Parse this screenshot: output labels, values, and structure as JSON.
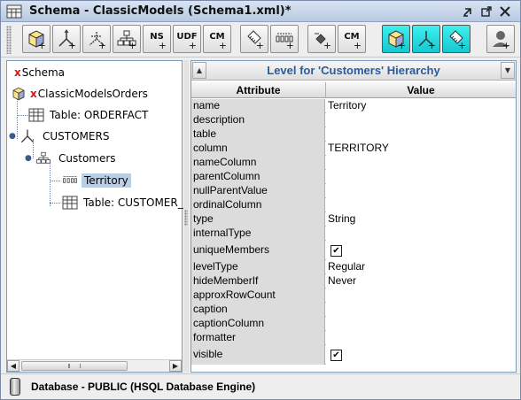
{
  "window": {
    "title": "Schema - ClassicModels (Schema1.xml)*"
  },
  "toolbar": {
    "tools": [
      {
        "name": "add-cube",
        "icon": "cube-icon",
        "label": ""
      },
      {
        "name": "add-dimension",
        "icon": "dimension-icon",
        "label": ""
      },
      {
        "name": "add-dimension-usage",
        "icon": "dimension-usage-icon",
        "label": ""
      },
      {
        "name": "add-hierarchy",
        "icon": "hierarchy-icon",
        "label": ""
      },
      {
        "name": "add-named-set",
        "icon": "named-set-icon",
        "label": "NS"
      },
      {
        "name": "add-udf",
        "icon": "udf-icon",
        "label": "UDF"
      },
      {
        "name": "add-calculated-member",
        "icon": "calculated-member-icon",
        "label": "CM"
      },
      {
        "name": "add-measure",
        "icon": "measure-icon",
        "label": ""
      },
      {
        "name": "add-level",
        "icon": "level-icon",
        "label": ""
      },
      {
        "name": "add-property",
        "icon": "property-icon",
        "label": ""
      },
      {
        "name": "add-calculated-member-2",
        "icon": "calculated-member-icon",
        "label": "CM"
      },
      {
        "name": "add-virtual-cube",
        "icon": "virtual-cube-icon",
        "label": ""
      },
      {
        "name": "add-virtual-dimension",
        "icon": "virtual-dimension-icon",
        "label": ""
      },
      {
        "name": "add-virtual-measure",
        "icon": "virtual-measure-icon",
        "label": ""
      },
      {
        "name": "add-role",
        "icon": "role-icon",
        "label": ""
      }
    ]
  },
  "tree": {
    "items": [
      {
        "label": "Schema",
        "prefix": "x"
      },
      {
        "label": "ClassicModelsOrders",
        "prefix": "x"
      },
      {
        "label": "Table: ORDERFACT"
      },
      {
        "label": "CUSTOMERS"
      },
      {
        "label": "Customers"
      },
      {
        "label": "Territory"
      },
      {
        "label": "Table: CUSTOMER_"
      }
    ]
  },
  "detail": {
    "title": "Level for 'Customers' Hierarchy",
    "headers": {
      "attribute": "Attribute",
      "value": "Value"
    },
    "rows": [
      {
        "key": "name",
        "value": "Territory"
      },
      {
        "key": "description",
        "value": ""
      },
      {
        "key": "table",
        "value": ""
      },
      {
        "key": "column",
        "value": "TERRITORY"
      },
      {
        "key": "nameColumn",
        "value": ""
      },
      {
        "key": "parentColumn",
        "value": ""
      },
      {
        "key": "nullParentValue",
        "value": ""
      },
      {
        "key": "ordinalColumn",
        "value": ""
      },
      {
        "key": "type",
        "value": "String"
      },
      {
        "key": "internalType",
        "value": ""
      },
      {
        "key": "uniqueMembers",
        "value": "",
        "checked": true
      },
      {
        "key": "levelType",
        "value": "Regular"
      },
      {
        "key": "hideMemberIf",
        "value": "Never"
      },
      {
        "key": "approxRowCount",
        "value": ""
      },
      {
        "key": "caption",
        "value": ""
      },
      {
        "key": "captionColumn",
        "value": ""
      },
      {
        "key": "formatter",
        "value": ""
      },
      {
        "key": "visible",
        "value": "",
        "checked": true
      }
    ]
  },
  "status": {
    "text": "Database - PUBLIC (HSQL Database Engine)"
  },
  "colors": {
    "title_accent": "#2b5b9a",
    "selection": "#b8cfe5",
    "x_marker": "#e01010",
    "active_tool": "#15c8d0"
  }
}
